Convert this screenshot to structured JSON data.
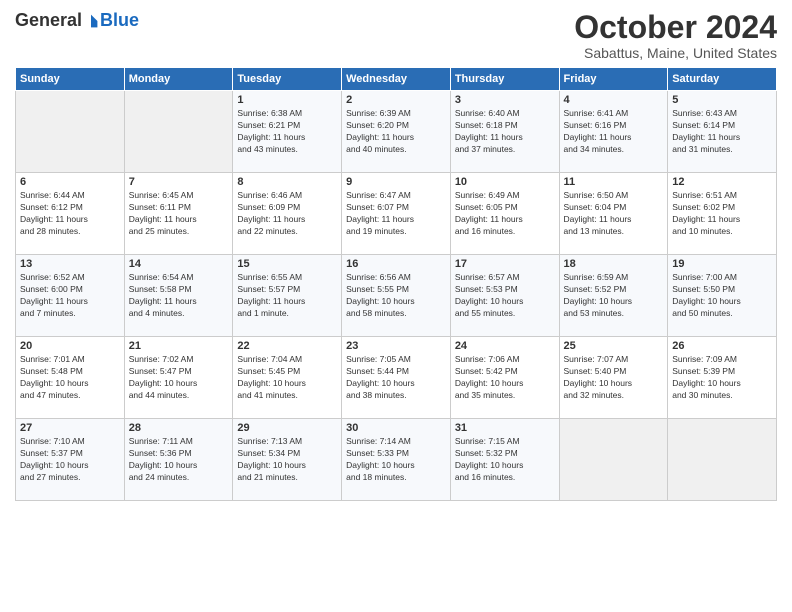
{
  "header": {
    "logo_general": "General",
    "logo_blue": "Blue",
    "month_title": "October 2024",
    "location": "Sabattus, Maine, United States"
  },
  "weekdays": [
    "Sunday",
    "Monday",
    "Tuesday",
    "Wednesday",
    "Thursday",
    "Friday",
    "Saturday"
  ],
  "weeks": [
    [
      {
        "day": "",
        "info": ""
      },
      {
        "day": "",
        "info": ""
      },
      {
        "day": "1",
        "info": "Sunrise: 6:38 AM\nSunset: 6:21 PM\nDaylight: 11 hours\nand 43 minutes."
      },
      {
        "day": "2",
        "info": "Sunrise: 6:39 AM\nSunset: 6:20 PM\nDaylight: 11 hours\nand 40 minutes."
      },
      {
        "day": "3",
        "info": "Sunrise: 6:40 AM\nSunset: 6:18 PM\nDaylight: 11 hours\nand 37 minutes."
      },
      {
        "day": "4",
        "info": "Sunrise: 6:41 AM\nSunset: 6:16 PM\nDaylight: 11 hours\nand 34 minutes."
      },
      {
        "day": "5",
        "info": "Sunrise: 6:43 AM\nSunset: 6:14 PM\nDaylight: 11 hours\nand 31 minutes."
      }
    ],
    [
      {
        "day": "6",
        "info": "Sunrise: 6:44 AM\nSunset: 6:12 PM\nDaylight: 11 hours\nand 28 minutes."
      },
      {
        "day": "7",
        "info": "Sunrise: 6:45 AM\nSunset: 6:11 PM\nDaylight: 11 hours\nand 25 minutes."
      },
      {
        "day": "8",
        "info": "Sunrise: 6:46 AM\nSunset: 6:09 PM\nDaylight: 11 hours\nand 22 minutes."
      },
      {
        "day": "9",
        "info": "Sunrise: 6:47 AM\nSunset: 6:07 PM\nDaylight: 11 hours\nand 19 minutes."
      },
      {
        "day": "10",
        "info": "Sunrise: 6:49 AM\nSunset: 6:05 PM\nDaylight: 11 hours\nand 16 minutes."
      },
      {
        "day": "11",
        "info": "Sunrise: 6:50 AM\nSunset: 6:04 PM\nDaylight: 11 hours\nand 13 minutes."
      },
      {
        "day": "12",
        "info": "Sunrise: 6:51 AM\nSunset: 6:02 PM\nDaylight: 11 hours\nand 10 minutes."
      }
    ],
    [
      {
        "day": "13",
        "info": "Sunrise: 6:52 AM\nSunset: 6:00 PM\nDaylight: 11 hours\nand 7 minutes."
      },
      {
        "day": "14",
        "info": "Sunrise: 6:54 AM\nSunset: 5:58 PM\nDaylight: 11 hours\nand 4 minutes."
      },
      {
        "day": "15",
        "info": "Sunrise: 6:55 AM\nSunset: 5:57 PM\nDaylight: 11 hours\nand 1 minute."
      },
      {
        "day": "16",
        "info": "Sunrise: 6:56 AM\nSunset: 5:55 PM\nDaylight: 10 hours\nand 58 minutes."
      },
      {
        "day": "17",
        "info": "Sunrise: 6:57 AM\nSunset: 5:53 PM\nDaylight: 10 hours\nand 55 minutes."
      },
      {
        "day": "18",
        "info": "Sunrise: 6:59 AM\nSunset: 5:52 PM\nDaylight: 10 hours\nand 53 minutes."
      },
      {
        "day": "19",
        "info": "Sunrise: 7:00 AM\nSunset: 5:50 PM\nDaylight: 10 hours\nand 50 minutes."
      }
    ],
    [
      {
        "day": "20",
        "info": "Sunrise: 7:01 AM\nSunset: 5:48 PM\nDaylight: 10 hours\nand 47 minutes."
      },
      {
        "day": "21",
        "info": "Sunrise: 7:02 AM\nSunset: 5:47 PM\nDaylight: 10 hours\nand 44 minutes."
      },
      {
        "day": "22",
        "info": "Sunrise: 7:04 AM\nSunset: 5:45 PM\nDaylight: 10 hours\nand 41 minutes."
      },
      {
        "day": "23",
        "info": "Sunrise: 7:05 AM\nSunset: 5:44 PM\nDaylight: 10 hours\nand 38 minutes."
      },
      {
        "day": "24",
        "info": "Sunrise: 7:06 AM\nSunset: 5:42 PM\nDaylight: 10 hours\nand 35 minutes."
      },
      {
        "day": "25",
        "info": "Sunrise: 7:07 AM\nSunset: 5:40 PM\nDaylight: 10 hours\nand 32 minutes."
      },
      {
        "day": "26",
        "info": "Sunrise: 7:09 AM\nSunset: 5:39 PM\nDaylight: 10 hours\nand 30 minutes."
      }
    ],
    [
      {
        "day": "27",
        "info": "Sunrise: 7:10 AM\nSunset: 5:37 PM\nDaylight: 10 hours\nand 27 minutes."
      },
      {
        "day": "28",
        "info": "Sunrise: 7:11 AM\nSunset: 5:36 PM\nDaylight: 10 hours\nand 24 minutes."
      },
      {
        "day": "29",
        "info": "Sunrise: 7:13 AM\nSunset: 5:34 PM\nDaylight: 10 hours\nand 21 minutes."
      },
      {
        "day": "30",
        "info": "Sunrise: 7:14 AM\nSunset: 5:33 PM\nDaylight: 10 hours\nand 18 minutes."
      },
      {
        "day": "31",
        "info": "Sunrise: 7:15 AM\nSunset: 5:32 PM\nDaylight: 10 hours\nand 16 minutes."
      },
      {
        "day": "",
        "info": ""
      },
      {
        "day": "",
        "info": ""
      }
    ]
  ]
}
